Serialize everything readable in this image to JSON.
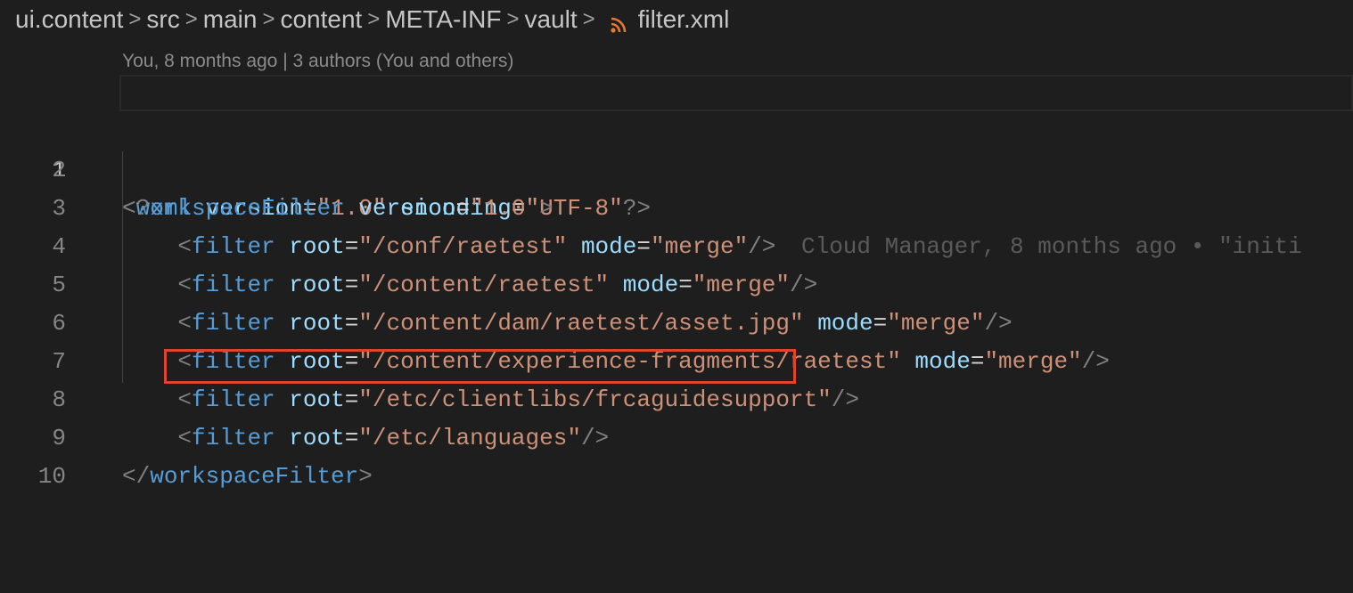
{
  "breadcrumb": {
    "items": [
      "ui.content",
      "src",
      "main",
      "content",
      "META-INF",
      "vault"
    ],
    "file": "filter.xml",
    "separator": ">"
  },
  "blame": {
    "header": "You, 8 months ago | 3 authors (You and others)",
    "inline": "Cloud Manager, 8 months ago • \"initi"
  },
  "editor": {
    "line_numbers": [
      "1",
      "2",
      "3",
      "4",
      "5",
      "6",
      "7",
      "8",
      "9",
      "10"
    ],
    "lines": {
      "l1": {
        "open": "<?",
        "tag": "xml",
        "a1": "version",
        "v1": "\"1.0\"",
        "a2": "encoding",
        "v2": "\"UTF-8\"",
        "close": "?>"
      },
      "l2": {
        "open": "<",
        "tag": "workspaceFilter",
        "a1": "version",
        "v1": "\"1.0\"",
        "close": ">"
      },
      "l3": {
        "tag": "filter",
        "a1": "root",
        "v1": "\"/conf/raetest\"",
        "a2": "mode",
        "v2": "\"merge\""
      },
      "l4": {
        "tag": "filter",
        "a1": "root",
        "v1": "\"/content/raetest\"",
        "a2": "mode",
        "v2": "\"merge\""
      },
      "l5": {
        "tag": "filter",
        "a1": "root",
        "v1": "\"/content/dam/raetest/asset.jpg\"",
        "a2": "mode",
        "v2": "\"merge\""
      },
      "l6": {
        "tag": "filter",
        "a1": "root",
        "v1": "\"/content/experience-fragments/raetest\"",
        "a2": "mode",
        "v2": "\"merge\""
      },
      "l7": {
        "tag": "filter",
        "a1": "root",
        "v1": "\"/etc/clientlibs/frcaguidesupport\""
      },
      "l8": {
        "tag": "filter",
        "a1": "root",
        "v1": "\"/etc/languages\""
      },
      "l9": {
        "open": "</",
        "tag": "workspaceFilter",
        "close": ">"
      }
    },
    "punct": {
      "lt": "<",
      "selfclose": "/>",
      "eq": "="
    }
  },
  "colors": {
    "background": "#1e1e1e",
    "tag": "#569cd6",
    "attribute": "#9cdcfe",
    "string": "#ce9178",
    "punctuation": "#808080",
    "highlight_box": "#e0422b",
    "rss_icon": "#e37933"
  },
  "icons": {
    "file_icon": "rss-icon"
  }
}
